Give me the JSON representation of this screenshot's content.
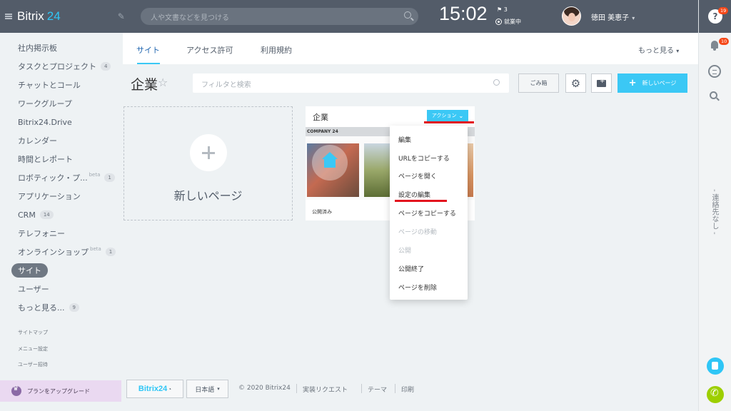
{
  "header": {
    "logo": "Bitrix",
    "logo_num": "24",
    "search_placeholder": "人や文書などを見つける",
    "clock": "15:02",
    "flag_count": "3",
    "work_status": "就業中",
    "user_name": "徳田 美恵子",
    "help_badge": "19"
  },
  "right_rail": {
    "notif_badge": "10",
    "contacts_text": "- 連絡先なし -"
  },
  "sidebar": {
    "items": [
      {
        "label": "社内掲示板"
      },
      {
        "label": "タスクとプロジェクト",
        "count": "4"
      },
      {
        "label": "チャットとコール"
      },
      {
        "label": "ワークグループ"
      },
      {
        "label": "Bitrix24.Drive"
      },
      {
        "label": "カレンダー"
      },
      {
        "label": "時間とレポート"
      },
      {
        "label": "ロボティック・プ...",
        "beta": "beta",
        "count": "1"
      },
      {
        "label": "アプリケーション"
      },
      {
        "label": "CRM",
        "count": "14"
      },
      {
        "label": "テレフォニー"
      },
      {
        "label": "オンラインショップ",
        "beta": "beta",
        "count": "1"
      },
      {
        "label": "サイト"
      },
      {
        "label": "ユーザー"
      },
      {
        "label": "もっと見る...",
        "count": "9"
      }
    ],
    "sitemap": "サイトマップ",
    "menu_settings": "メニュー設定",
    "invite": "ユーザー招待",
    "upgrade": "プランをアップグレード"
  },
  "tabs": {
    "site": "サイト",
    "access": "アクセス許可",
    "terms": "利用規約",
    "more": "もっと見る"
  },
  "toolbar": {
    "title": "企業",
    "filter_placeholder": "フィルタと検索",
    "trash": "ごみ箱",
    "new_page": "新しいページ"
  },
  "new_tile": {
    "label": "新しいページ"
  },
  "card": {
    "name": "企業",
    "action": "アクション",
    "thumb_header": "COMPANY 24",
    "status": "公開済み"
  },
  "dropdown": {
    "items": [
      {
        "label": "編集",
        "disabled": false
      },
      {
        "label": "URLをコピーする",
        "disabled": false
      },
      {
        "label": "ページを開く",
        "disabled": false
      },
      {
        "label": "設定の編集",
        "disabled": false
      },
      {
        "label": "ページをコピーする",
        "disabled": false
      },
      {
        "label": "ページの移動",
        "disabled": true
      },
      {
        "label": "公開",
        "disabled": true
      },
      {
        "label": "公開終了",
        "disabled": false
      },
      {
        "label": "ページを削除",
        "disabled": false
      }
    ]
  },
  "footer": {
    "b24": "Bitrix24",
    "lang": "日本語",
    "copyright": "© 2020 Bitrix24",
    "request": "実装リクエスト",
    "theme": "テーマ",
    "print": "印刷"
  }
}
